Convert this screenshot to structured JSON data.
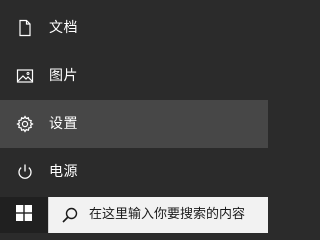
{
  "start_menu": {
    "items": [
      {
        "label": "文档",
        "icon": "document-icon"
      },
      {
        "label": "图片",
        "icon": "pictures-icon"
      },
      {
        "label": "设置",
        "icon": "settings-gear-icon",
        "hovered": true
      },
      {
        "label": "电源",
        "icon": "power-icon"
      }
    ]
  },
  "taskbar": {
    "start_icon": "windows-logo-icon",
    "search": {
      "placeholder": "在这里输入你要搜索的内容",
      "icon": "search-icon"
    }
  },
  "colors": {
    "menu_background": "#2b2b2b",
    "hover_background": "#474747",
    "taskbar_background": "#202020",
    "search_background": "#f2f2f2",
    "text": "#ffffff"
  }
}
